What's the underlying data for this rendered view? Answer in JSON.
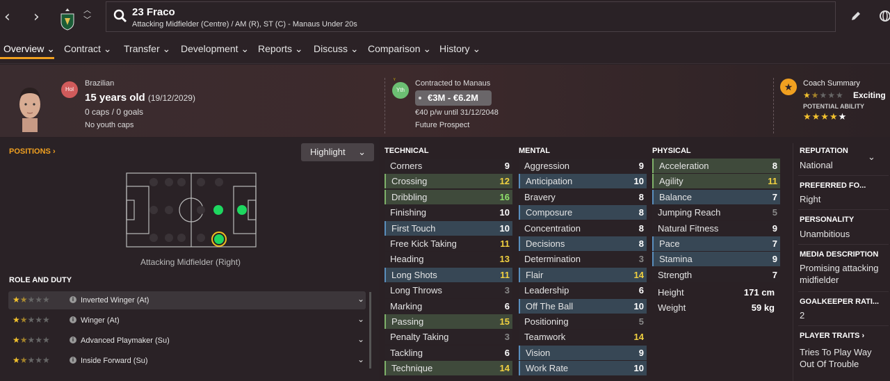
{
  "topbar": {
    "back": "‹",
    "forward": "›",
    "name": "23 Fraco",
    "subtitle": "Attacking Midfielder (Centre) / AM (R), ST (C) - Manaus Under 20s"
  },
  "menu": [
    "Overview",
    "Contract",
    "Transfer",
    "Development",
    "Reports",
    "Discuss",
    "Comparison",
    "History"
  ],
  "player": {
    "nationality_badge": "Hol",
    "nationality": "Brazilian",
    "age": "15 years old",
    "dob": "(19/12/2029)",
    "caps": "0 caps / 0 goals",
    "youth_caps": "No youth caps"
  },
  "contract": {
    "badge": "Yth",
    "title": "Contracted to Manaus",
    "value": "€3M - €6.2M",
    "wage": "€40 p/w until 31/12/2048",
    "status": "Future Prospect"
  },
  "coach": {
    "title": "Coach Summary",
    "summary": "Exciting",
    "pa_label": "POTENTIAL ABILITY",
    "current_stars": 1.5,
    "potential_stars": 4.5
  },
  "positions": {
    "title": "POSITIONS ›",
    "highlight": "Highlight",
    "label": "Attacking Midfielder (Right)"
  },
  "roles": {
    "title": "ROLE AND DUTY",
    "items": [
      {
        "name": "Inverted Winger (At)",
        "stars": 1.5
      },
      {
        "name": "Winger (At)",
        "stars": 1.5
      },
      {
        "name": "Advanced Playmaker (Su)",
        "stars": 1.5
      },
      {
        "name": "Inside Forward (Su)",
        "stars": 1.5
      }
    ]
  },
  "technical": {
    "title": "TECHNICAL",
    "items": [
      {
        "n": "Corners",
        "v": "9",
        "s": "plain",
        "c": ""
      },
      {
        "n": "Crossing",
        "v": "12",
        "s": "g",
        "c": "v-yellow"
      },
      {
        "n": "Dribbling",
        "v": "16",
        "s": "g",
        "c": "v-green"
      },
      {
        "n": "Finishing",
        "v": "10",
        "s": "plain",
        "c": ""
      },
      {
        "n": "First Touch",
        "v": "10",
        "s": "b",
        "c": ""
      },
      {
        "n": "Free Kick Taking",
        "v": "11",
        "s": "plain",
        "c": "v-yellow"
      },
      {
        "n": "Heading",
        "v": "13",
        "s": "plain",
        "c": "v-yellow"
      },
      {
        "n": "Long Shots",
        "v": "11",
        "s": "b",
        "c": "v-yellow"
      },
      {
        "n": "Long Throws",
        "v": "3",
        "s": "plain",
        "c": "v-grey"
      },
      {
        "n": "Marking",
        "v": "6",
        "s": "plain",
        "c": ""
      },
      {
        "n": "Passing",
        "v": "15",
        "s": "g",
        "c": "v-yellow"
      },
      {
        "n": "Penalty Taking",
        "v": "3",
        "s": "plain",
        "c": "v-grey"
      },
      {
        "n": "Tackling",
        "v": "6",
        "s": "plain",
        "c": ""
      },
      {
        "n": "Technique",
        "v": "14",
        "s": "g",
        "c": "v-yellow"
      }
    ]
  },
  "mental": {
    "title": "MENTAL",
    "items": [
      {
        "n": "Aggression",
        "v": "9",
        "s": "plain",
        "c": ""
      },
      {
        "n": "Anticipation",
        "v": "10",
        "s": "b",
        "c": ""
      },
      {
        "n": "Bravery",
        "v": "8",
        "s": "plain",
        "c": ""
      },
      {
        "n": "Composure",
        "v": "8",
        "s": "b",
        "c": ""
      },
      {
        "n": "Concentration",
        "v": "8",
        "s": "plain",
        "c": ""
      },
      {
        "n": "Decisions",
        "v": "8",
        "s": "b",
        "c": ""
      },
      {
        "n": "Determination",
        "v": "3",
        "s": "plain",
        "c": "v-grey"
      },
      {
        "n": "Flair",
        "v": "14",
        "s": "b",
        "c": "v-yellow"
      },
      {
        "n": "Leadership",
        "v": "6",
        "s": "plain",
        "c": ""
      },
      {
        "n": "Off The Ball",
        "v": "10",
        "s": "b",
        "c": ""
      },
      {
        "n": "Positioning",
        "v": "5",
        "s": "plain",
        "c": "v-grey"
      },
      {
        "n": "Teamwork",
        "v": "14",
        "s": "plain",
        "c": "v-yellow"
      },
      {
        "n": "Vision",
        "v": "9",
        "s": "b",
        "c": ""
      },
      {
        "n": "Work Rate",
        "v": "10",
        "s": "b",
        "c": ""
      }
    ]
  },
  "physical": {
    "title": "PHYSICAL",
    "items": [
      {
        "n": "Acceleration",
        "v": "8",
        "s": "g",
        "c": ""
      },
      {
        "n": "Agility",
        "v": "11",
        "s": "g",
        "c": "v-yellow"
      },
      {
        "n": "Balance",
        "v": "7",
        "s": "b",
        "c": ""
      },
      {
        "n": "Jumping Reach",
        "v": "5",
        "s": "plain",
        "c": "v-grey"
      },
      {
        "n": "Natural Fitness",
        "v": "9",
        "s": "plain",
        "c": ""
      },
      {
        "n": "Pace",
        "v": "7",
        "s": "b",
        "c": ""
      },
      {
        "n": "Stamina",
        "v": "9",
        "s": "b",
        "c": ""
      },
      {
        "n": "Strength",
        "v": "7",
        "s": "plain",
        "c": ""
      }
    ],
    "height_label": "Height",
    "height": "171 cm",
    "weight_label": "Weight",
    "weight": "59 kg"
  },
  "side": {
    "reputation_title": "REPUTATION",
    "reputation": "National",
    "foot_title": "PREFERRED FO...",
    "foot": "Right",
    "personality_title": "PERSONALITY",
    "personality": "Unambitious",
    "media_title": "MEDIA DESCRIPTION",
    "media": "Promising attacking midfielder",
    "gk_title": "GOALKEEPER RATI...",
    "gk": "2",
    "traits_title": "PLAYER TRAITS ›",
    "traits": "Tries To Play Way Out Of Trouble"
  },
  "colors": {
    "accent": "#f0a020",
    "green_bar": "#7fb26a",
    "blue_bar": "#5a8ebd"
  }
}
